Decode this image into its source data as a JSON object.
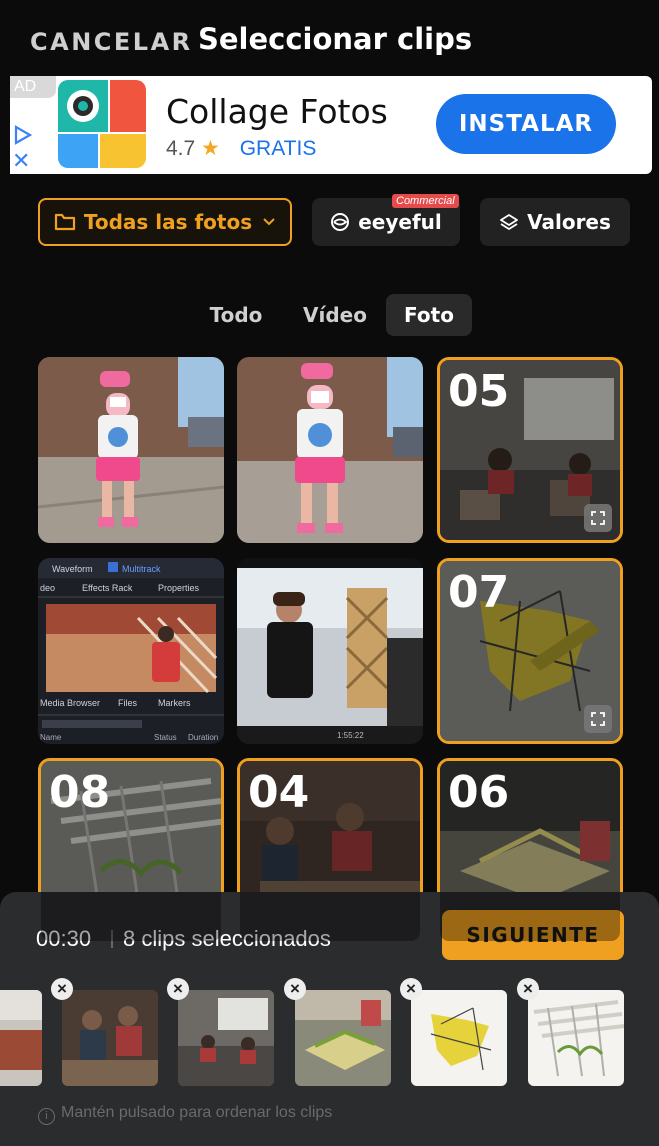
{
  "header": {
    "cancel_label": "CANCELAR",
    "title": "Seleccionar clips"
  },
  "ad": {
    "tag": "AD",
    "app_name": "Collage Fotos",
    "rating": "4.7",
    "price": "GRATIS",
    "install_label": "INSTALAR",
    "accent_color": "#1a73e8"
  },
  "filters": {
    "album_label": "Todas las fotos",
    "eeyeful_label": "eeyeful",
    "commercial_badge": "Commercial",
    "valores_label": "Valores"
  },
  "tabs": [
    {
      "label": "Todo",
      "active": false
    },
    {
      "label": "Vídeo",
      "active": false
    },
    {
      "label": "Foto",
      "active": true
    }
  ],
  "grid": [
    {
      "selected": false,
      "order": "",
      "subject": "girl-pink-cap"
    },
    {
      "selected": false,
      "order": "",
      "subject": "girl-pink-cap-2"
    },
    {
      "selected": true,
      "order": "05",
      "subject": "classroom"
    },
    {
      "selected": false,
      "order": "",
      "subject": "editor-screenshot"
    },
    {
      "selected": false,
      "order": "",
      "subject": "girl-wooden-structure"
    },
    {
      "selected": true,
      "order": "07",
      "subject": "chair-sketch"
    },
    {
      "selected": true,
      "order": "08",
      "subject": "pergola-sketch"
    },
    {
      "selected": true,
      "order": "04",
      "subject": "students-table"
    },
    {
      "selected": true,
      "order": "06",
      "subject": "model-building"
    }
  ],
  "editor_screenshot": {
    "tab_waveform": "Waveform",
    "tab_multitrack": "Multitrack",
    "panel_video": "deo",
    "panel_effects": "Effects Rack",
    "panel_properties": "Properties",
    "panel_media": "Media Browser",
    "panel_files": "Files",
    "panel_markers": "Markers",
    "col_name": "Name",
    "col_status": "Status",
    "col_duration": "Duration"
  },
  "video_time": "1:55:22",
  "selection": {
    "duration": "00:30",
    "count_text": "8 clips seleccionados",
    "next_label": "SIGUIENTE",
    "hint": "Mantén pulsado para ordenar los clips"
  },
  "colors": {
    "accent": "#f0a020",
    "background": "#0b0b0b",
    "sheet": "#2b2c2e"
  }
}
